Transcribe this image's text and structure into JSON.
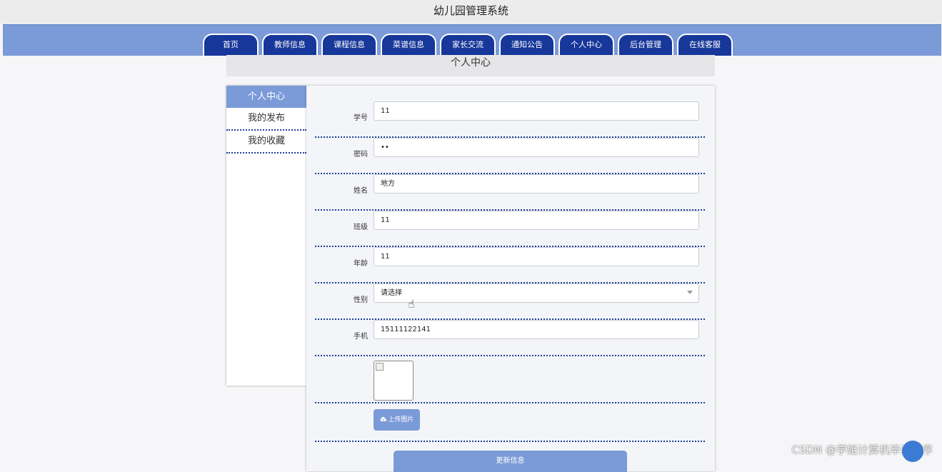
{
  "app": {
    "title": "幼儿园管理系统"
  },
  "nav": {
    "tabs": [
      {
        "label": "首页"
      },
      {
        "label": "教师信息"
      },
      {
        "label": "课程信息"
      },
      {
        "label": "菜谱信息"
      },
      {
        "label": "家长交流"
      },
      {
        "label": "通知公告"
      },
      {
        "label": "个人中心"
      },
      {
        "label": "后台管理"
      },
      {
        "label": "在线客服"
      }
    ]
  },
  "page": {
    "section_title": "个人中心"
  },
  "sidebar": {
    "items": [
      {
        "label": "个人中心",
        "active": true
      },
      {
        "label": "我的发布",
        "active": false
      },
      {
        "label": "我的收藏",
        "active": false
      }
    ]
  },
  "form": {
    "fields": [
      {
        "label": "学号",
        "value": "11"
      },
      {
        "label": "密码",
        "value": "••"
      },
      {
        "label": "姓名",
        "value": "地方"
      },
      {
        "label": "班级",
        "value": "11"
      },
      {
        "label": "年龄",
        "value": "11"
      },
      {
        "label": "性别",
        "value": "请选择"
      },
      {
        "label": "手机",
        "value": "15111122141"
      }
    ],
    "upload_label": "上传图片",
    "submit_label": "更新信息"
  },
  "watermark": "CSDN @学姐计算机毕设程序",
  "colors": {
    "accent": "#7b9ad8",
    "nav_tab": "#17379a",
    "divider": "#1f3f9a"
  },
  "icons": {
    "upload": "cloud-upload-icon",
    "image": "broken-image-icon",
    "select": "chevron-down-icon"
  }
}
